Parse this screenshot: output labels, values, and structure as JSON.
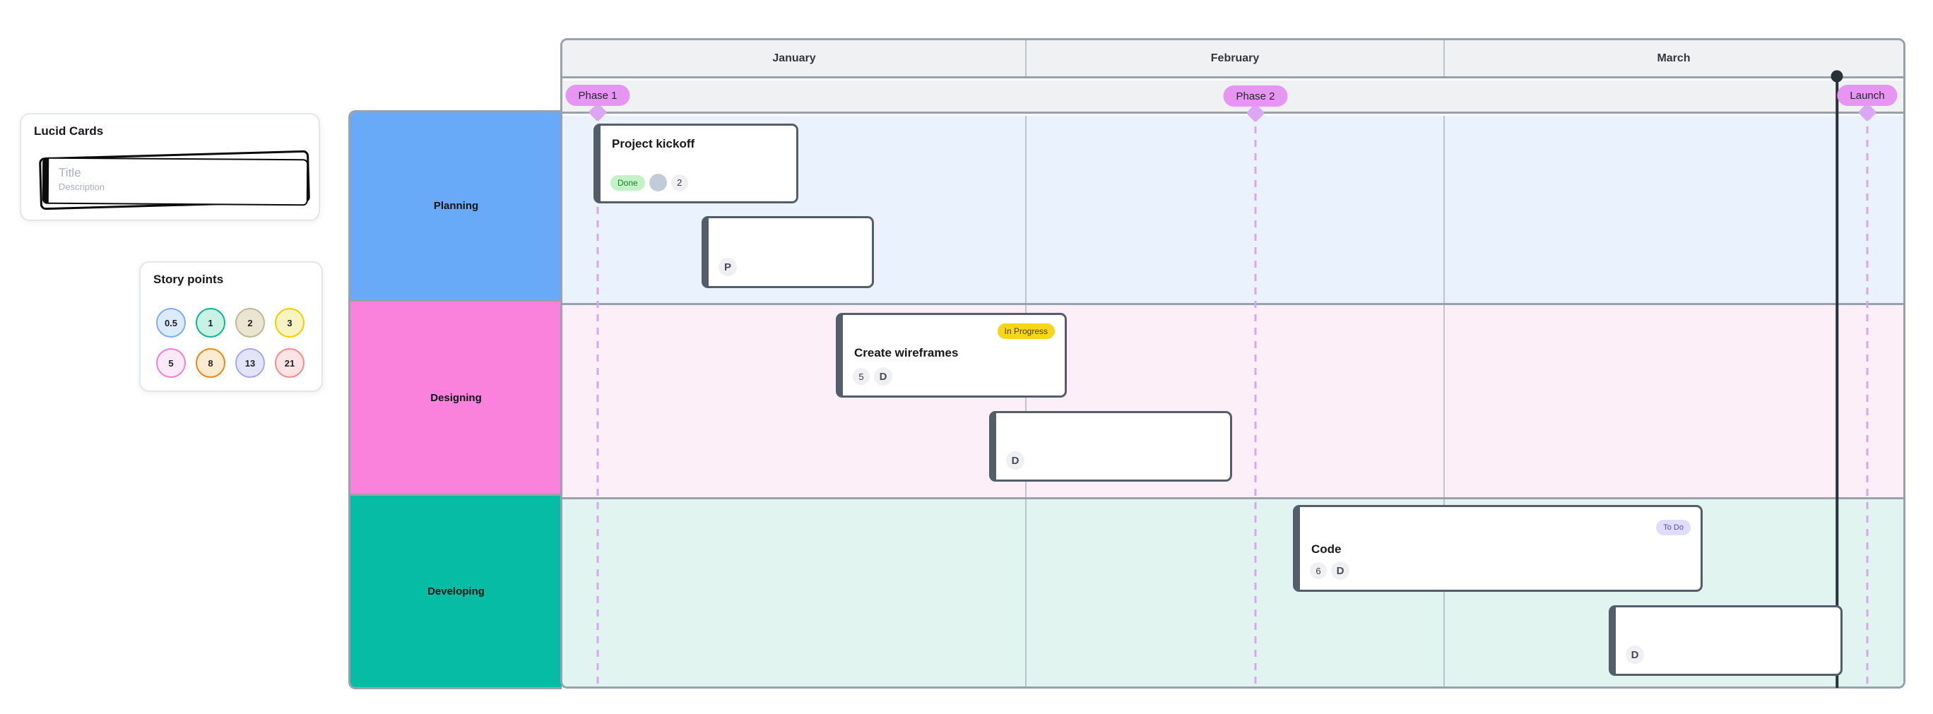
{
  "palettes": {
    "lucid_cards": {
      "title": "Lucid Cards",
      "card_template": {
        "title_placeholder": "Title",
        "description_placeholder": "Description"
      }
    },
    "story_points": {
      "title": "Story points",
      "points": [
        {
          "value": "0.5",
          "fill": "#dcebfb",
          "border": "#7faef5"
        },
        {
          "value": "1",
          "fill": "#c9f2e4",
          "border": "#0db592"
        },
        {
          "value": "2",
          "fill": "#e9e5d0",
          "border": "#c0b894"
        },
        {
          "value": "3",
          "fill": "#f8f4c1",
          "border": "#f5ce02"
        },
        {
          "value": "5",
          "fill": "#fce9f7",
          "border": "#f77fd0"
        },
        {
          "value": "8",
          "fill": "#fdebd0",
          "border": "#f08616"
        },
        {
          "value": "13",
          "fill": "#e3e3f9",
          "border": "#a8a8f0"
        },
        {
          "value": "21",
          "fill": "#fce4e4",
          "border": "#f58b8b"
        }
      ]
    }
  },
  "timeline": {
    "months": [
      {
        "label": "January"
      },
      {
        "label": "February"
      },
      {
        "label": "March"
      }
    ],
    "milestones": [
      {
        "label": "Phase 1"
      },
      {
        "label": "Phase 2"
      },
      {
        "label": "Launch"
      }
    ],
    "lanes": [
      {
        "label": "Planning",
        "color": "#68aaf8",
        "track_bg": "#eaf2fd"
      },
      {
        "label": "Designing",
        "color": "#fb82dc",
        "track_bg": "#fdeff8"
      },
      {
        "label": "Developing",
        "color": "#06bca4",
        "track_bg": "#e1f4ef"
      }
    ],
    "cards": [
      {
        "title": "Project kickoff",
        "status": "Done",
        "status_bg": "#c2f2c6",
        "status_fg": "#19802b",
        "points": "2"
      },
      {
        "assignee": "P"
      },
      {
        "title": "Create wireframes",
        "status": "In Progress",
        "status_bg": "#f6d616",
        "status_fg": "#4a4407",
        "points": "5",
        "assignee": "D"
      },
      {
        "assignee": "D"
      },
      {
        "title": "Code",
        "status": "To Do",
        "status_bg": "#dfddfb",
        "status_fg": "#544bc2",
        "points": "6",
        "assignee": "D"
      },
      {
        "assignee": "D"
      }
    ]
  }
}
